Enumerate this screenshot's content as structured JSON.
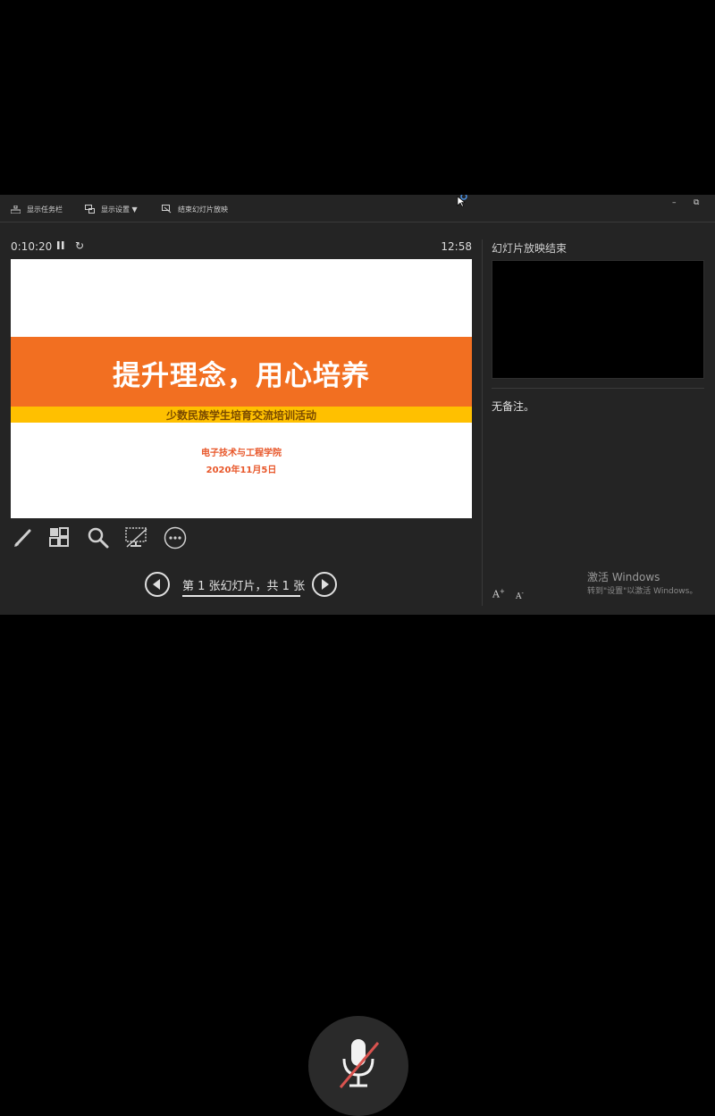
{
  "toolbar": {
    "show_taskbar": "显示任务栏",
    "display_settings": "显示设置 ▼",
    "end_slideshow": "结束幻灯片放映",
    "minimize": "–",
    "restore": "⧉"
  },
  "status": {
    "elapsed_time": "0:10:20",
    "clock": "12:58",
    "restart_glyph": "↻"
  },
  "slide": {
    "title": "提升理念，用心培养",
    "subtitle": "少数民族学生培育交流培训活动",
    "organization": "电子技术与工程学院",
    "date": "2020年11月5日"
  },
  "navigation": {
    "counter": "第 1 张幻灯片，共 1 张"
  },
  "next_panel": {
    "title": "幻灯片放映结束"
  },
  "notes": {
    "text": "无备注。",
    "increase_font": "A",
    "decrease_font": "A"
  },
  "watermark": {
    "line1": "激活 Windows",
    "line2": "转到\"设置\"以激活 Windows。"
  },
  "colors": {
    "slide_band": "#f26f21",
    "slide_subband": "#ffc000",
    "slide_accent_text": "#e8572a",
    "panel_bg": "#242424"
  }
}
